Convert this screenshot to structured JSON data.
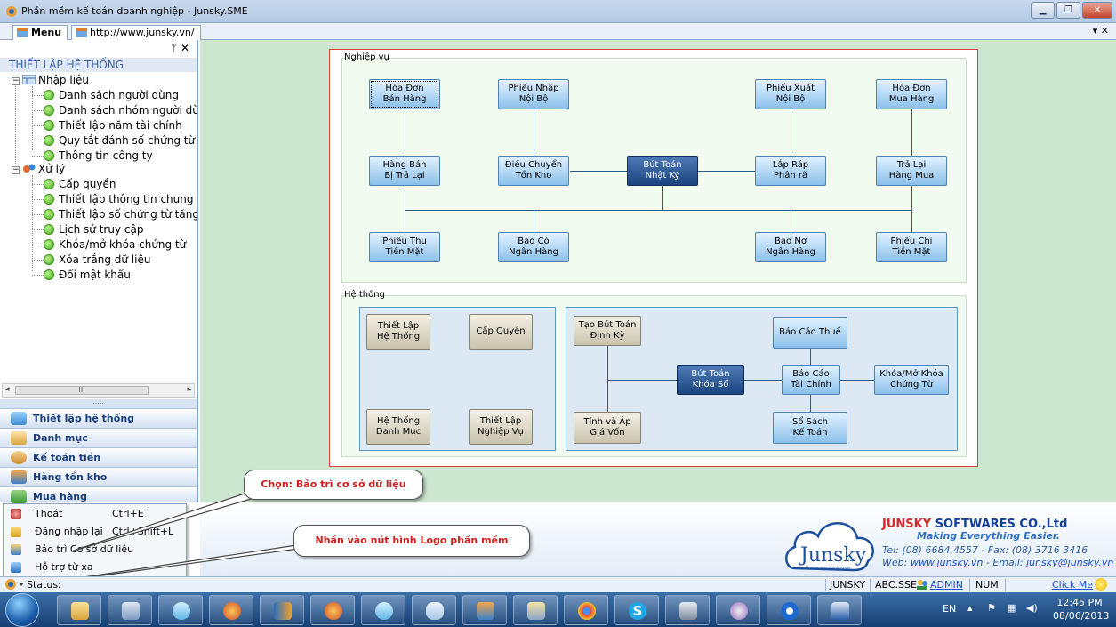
{
  "window": {
    "title": "Phần mềm kế toán doanh nghiệp - Junsky.SME"
  },
  "tabs": [
    {
      "label": "Menu"
    },
    {
      "label": "http://www.junsky.vn/"
    }
  ],
  "tab_menu_symbol": "▾ ✕",
  "left_panel": {
    "pin": "ᛘ",
    "close": "✕",
    "title": "THIẾT LẬP HỆ THỐNG",
    "tree": {
      "group1": "Nhập liệu",
      "group1_items": [
        "Danh sách người dùng",
        "Danh sách nhóm người dùn",
        "Thiết lập năm tài chính",
        "Quy tắt đánh số chứng từ tự",
        "Thông tin công ty"
      ],
      "group2": "Xử lý",
      "group2_items": [
        "Cấp quyền",
        "Thiết lập thông tin chung",
        "Thiết lập số chứng từ tăng t",
        "Lịch sử truy cập",
        "Khóa/mở khóa chứng từ",
        "Xóa trắng dữ liệu",
        "Đổi mật khẩu"
      ]
    },
    "nav": [
      "Thiết lập hệ thống",
      "Danh mục",
      "Kế toán tiền",
      "Hàng tồn kho",
      "Mua hàng"
    ]
  },
  "diagram": {
    "section1": "Nghiệp vụ",
    "section2": "Hệ thống",
    "n_hoadon_ban": [
      "Hóa Đơn",
      "Bán Hàng"
    ],
    "n_phieunhap": [
      "Phiếu Nhập",
      "Nội Bộ"
    ],
    "n_phieuxuat": [
      "Phiếu Xuất",
      "Nội Bộ"
    ],
    "n_hoadon_mua": [
      "Hóa Đơn",
      "Mua Hàng"
    ],
    "n_hangban": [
      "Hàng Bán",
      "Bị Trả Lại"
    ],
    "n_dieuchuyen": [
      "Điều Chuyển",
      "Tồn Kho"
    ],
    "n_buttoan": [
      "Bút Toán",
      "Nhật Ký"
    ],
    "n_laprap": [
      "Lắp Ráp",
      "Phân rã"
    ],
    "n_tralai": [
      "Trả Lại",
      "Hàng Mua"
    ],
    "n_phieuthu": [
      "Phiếu Thu",
      "Tiền Mặt"
    ],
    "n_baoco": [
      "Báo Có",
      "Ngân Hàng"
    ],
    "n_baono": [
      "Báo Nợ",
      "Ngân Hàng"
    ],
    "n_phieuchi": [
      "Phiếu Chi",
      "Tiền Mặt"
    ],
    "s_thietlap_ht": [
      "Thiết Lập",
      "Hệ Thống"
    ],
    "s_capquyen": [
      "Cấp Quyền"
    ],
    "s_hethong_dm": [
      "Hệ Thống",
      "Danh Mục"
    ],
    "s_thietlap_nv": [
      "Thiết Lập",
      "Nghiệp Vụ"
    ],
    "s_taobuttoan": [
      "Tạo Bút Toán",
      "Định Kỳ"
    ],
    "s_baocaothue": [
      "Báo Cáo Thuế"
    ],
    "s_buttoan_khoaso": [
      "Bút Toán",
      "Khóa Sổ"
    ],
    "s_baocao_tc": [
      "Báo Cáo",
      "Tài Chính"
    ],
    "s_khoamokhoa": [
      "Khóa/Mở Khóa",
      "Chứng Từ"
    ],
    "s_tinhgiavon": [
      "Tính và Áp",
      "Giá Vốn"
    ],
    "s_sosach": [
      "Sổ Sách",
      "Kế Toán"
    ]
  },
  "footer": {
    "logo_text": "Junsky",
    "logo_sub": "Making everything easier",
    "company_hl": "JUNSKY",
    "company_rest": " SOFTWARES CO.,Ltd",
    "slogan": "Making Everything Easier.",
    "contact1": "Tel: (08) 6684 4557 - Fax: (08) 3716 3416",
    "web_label": "Web: ",
    "web": "www.junsky.vn",
    "email_label": " - Email: ",
    "email": "junsky@junsky.vn"
  },
  "popup_menu": [
    {
      "label": "Thoát",
      "shortcut": "Ctrl+E"
    },
    {
      "label": "Đăng nhập lại",
      "shortcut": "Ctrl+Shift+L"
    },
    {
      "label": "Bảo trì Cơ sở dữ liệu",
      "shortcut": ""
    },
    {
      "label": "Hỗ trợ từ xa",
      "shortcut": ""
    }
  ],
  "callouts": {
    "c1": "Chọn: Bảo trì cơ sở dữ liệu",
    "c2": "Nhấn vào nút hình Logo phần mềm"
  },
  "status": {
    "label": "Status:",
    "company": "JUNSKY",
    "db": "ABC.SSE",
    "user": "ADMIN",
    "num": "NUM",
    "clickme": "Click Me"
  },
  "tray": {
    "lang": "EN",
    "time": "12:45 PM",
    "date": "08/06/2013"
  }
}
